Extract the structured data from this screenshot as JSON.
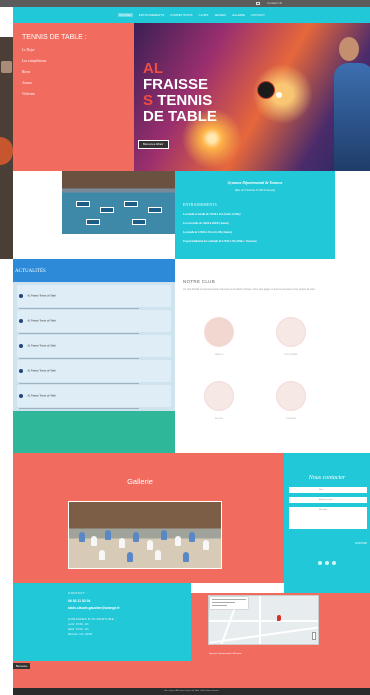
{
  "topbar": {
    "contact_text": "Contact Us"
  },
  "nav": {
    "items": [
      "ACCUEIL",
      "ENTRAINEMENTS",
      "COMPETITIONS",
      "CLUBS",
      "JEUNES",
      "GALERIE",
      "CONTACT"
    ],
    "active": "ACCUEIL"
  },
  "hero": {
    "menu_title": "TENNIS DE TABLE :",
    "menu_items": [
      "Le Dojet",
      "Les compétitions",
      "Biens",
      "Jeunes",
      "Vétérans"
    ],
    "title_lines": [
      "AL",
      "FRAISSE",
      "S",
      "TENNIS",
      "DE TABLE"
    ],
    "button": "Bienvenue Alfrais'"
  },
  "gym": {
    "name": "Gymnase Départemental de Tostouse",
    "address": "(Rue de l'Ovalade 33 000 Toulouse)",
    "heading": "ENTRAINEMENTS",
    "rows": [
      "Les lundis et mardis de 17h30 à 21h (Loisir et Elite)",
      "Les mercredis de 14h00 à 20h30 (Jeunes)",
      "Les jeudis de 17h30 à 21h et le 20h (Jeunes)",
      "Et ponctuellement les vendredis de 17h30 à 21h (Elites / Tournois)"
    ]
  },
  "actu": {
    "title": "ACTUALITÉS",
    "posts": [
      "AL Fraisse Tennis de Table",
      "AL Fraisse Tennis de Table",
      "AL Fraisse Tennis de Table",
      "AL Fraisse Tennis de Table",
      "AL Fraisse Tennis de Table"
    ]
  },
  "club": {
    "title": "NOTRE CLUB",
    "intro": "Un club familial et loyal au bureau d'anciens et d'enfants motivés. Vous êtes gagné et avec les bureaux et les projets de club.",
    "items": [
      "Valeurs",
      "Convivialité",
      "Jeunes",
      "Vétérans"
    ]
  },
  "galerie": {
    "title": "Gallerie"
  },
  "contact_form": {
    "title": "Nous contacter",
    "fields": [
      "Nom",
      "Adresse e-mail",
      "Message"
    ],
    "submit": "ENVOYER"
  },
  "info": {
    "contact_label": "CONTACT :",
    "phone": "06 83 11 82 04",
    "email": "alain-claude.gaucher@orange.fr",
    "hours_label": "HORAIRES D'OUVERTURE :",
    "hours": [
      "Lundi : 17h30 - 21h",
      "Mardi : 17h30 - 21h",
      "Mercredi : 14h - 20h30"
    ]
  },
  "map": {
    "caption": "Gymnase Départemental - Al Fraisse"
  },
  "foot_button": "Bienvenue",
  "footer": {
    "text": "Site créé par Al Fraisse Tennis de Table | Tous droits réservés"
  },
  "colors": {
    "coral": "#f26b5f",
    "cyan": "#21c8d8",
    "blue": "#2d8ad8",
    "teal": "#2fb79a"
  }
}
